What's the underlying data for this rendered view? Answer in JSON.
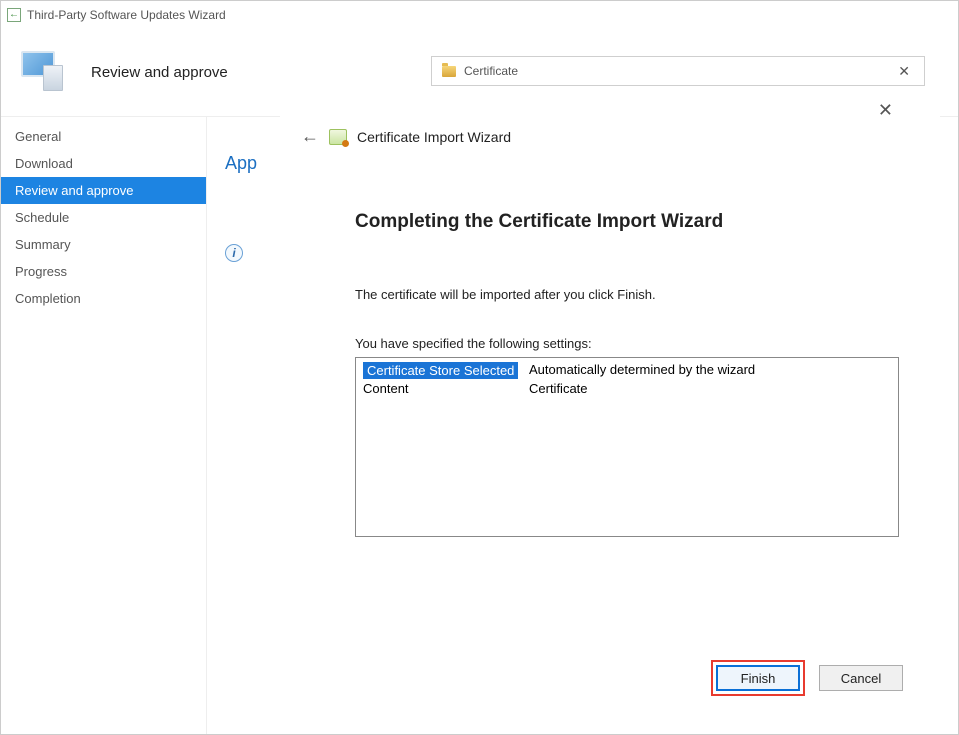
{
  "window": {
    "title": "Third-Party Software Updates Wizard"
  },
  "header": {
    "title": "Review and approve"
  },
  "sidebar": {
    "items": [
      {
        "label": "General"
      },
      {
        "label": "Download"
      },
      {
        "label": "Review and approve"
      },
      {
        "label": "Schedule"
      },
      {
        "label": "Summary"
      },
      {
        "label": "Progress"
      },
      {
        "label": "Completion"
      }
    ],
    "active_index": 2
  },
  "background_content": {
    "heading_partial": "App"
  },
  "cert_tab": {
    "title": "Certificate"
  },
  "cert_wizard": {
    "title": "Certificate Import Wizard",
    "heading": "Completing the Certificate Import Wizard",
    "description": "The certificate will be imported after you click Finish.",
    "settings_intro": "You have specified the following settings:",
    "rows": [
      {
        "label": "Certificate Store Selected",
        "value": "Automatically determined by the wizard"
      },
      {
        "label": "Content",
        "value": "Certificate"
      }
    ],
    "buttons": {
      "finish": "Finish",
      "cancel": "Cancel"
    }
  }
}
